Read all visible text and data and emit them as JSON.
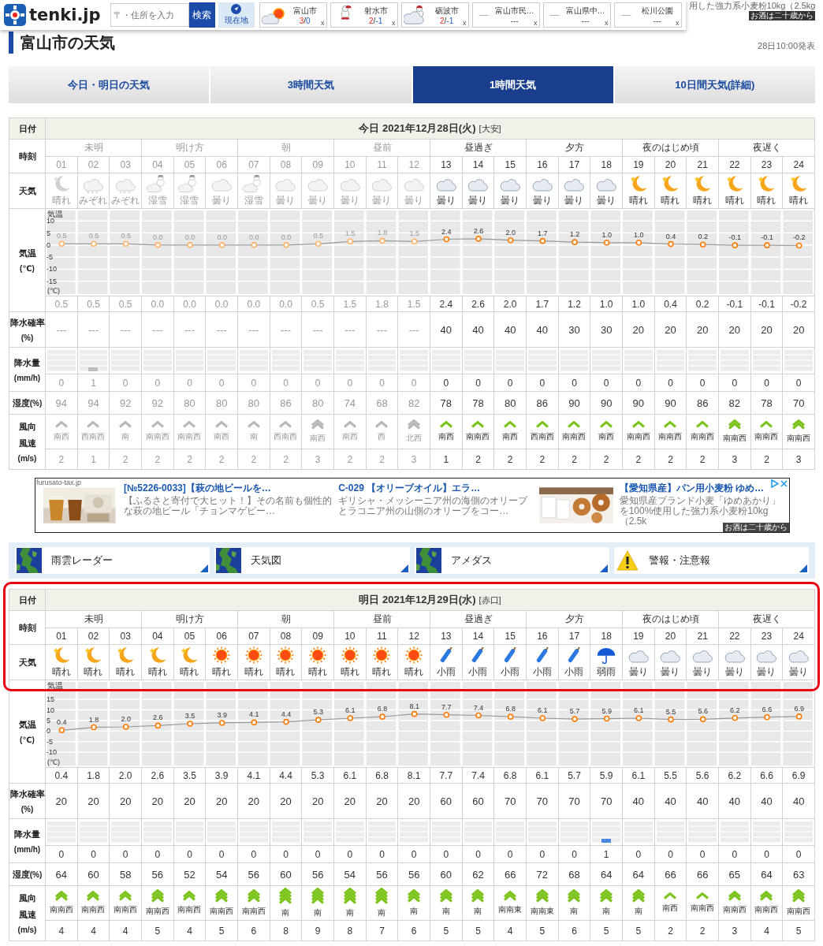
{
  "header": {
    "logo": "tenki.jp",
    "search": {
      "placeholder": "〒・住所を入力",
      "button": "検索"
    },
    "current_location": "現在地",
    "locations": [
      {
        "kind": "sun_cloud",
        "name": "富山市",
        "high": "3",
        "sep": "/",
        "low": "0",
        "close": "x"
      },
      {
        "kind": "snowman",
        "name": "射水市",
        "high": "2",
        "sep": "/",
        "low": "-1",
        "close": "x"
      },
      {
        "kind": "snow_cloud",
        "name": "砺波市",
        "high": "2",
        "sep": "/",
        "low": "-1",
        "close": "x"
      },
      {
        "kind": "empty",
        "mark": "—",
        "name": "富山市民…",
        "value": "---",
        "close": "x"
      },
      {
        "kind": "empty",
        "mark": "—",
        "name": "富山県中…",
        "value": "---",
        "close": "x"
      },
      {
        "kind": "empty",
        "mark": "—",
        "name": "松川公園",
        "value": "---",
        "close": "x"
      }
    ],
    "ad_fragment": {
      "text": "用した強力系小麦粉10kg（2.5kg",
      "badge": "お酒は二十歳から"
    }
  },
  "page": {
    "title": "富山市の天気",
    "issued": "28日10:00発表"
  },
  "tabs": [
    {
      "label": "今日・明日の天気",
      "selected": false
    },
    {
      "label": "3時間天気",
      "selected": false
    },
    {
      "label": "1時間天気",
      "selected": true
    },
    {
      "label": "10日間天気(詳細)",
      "selected": false
    }
  ],
  "tables": [
    {
      "highlighted": false,
      "date": "今日 2021年12月28日(火)",
      "rokuyo": "[大安]",
      "labels": {
        "date": "日付",
        "time": "時刻",
        "weather": "天気",
        "temp": "気温",
        "temp_unit": "(℃)",
        "pop": "降水確率",
        "pop_unit": "(%)",
        "rain": "降水量",
        "rain_unit": "(mm/h)",
        "humidity": "湿度",
        "humidity_unit": "(%)",
        "wind_dir": "風向",
        "wind_speed": "風速",
        "wind_unit": "(m/s)"
      },
      "periods": [
        {
          "label": "未明",
          "past": true
        },
        {
          "label": "明け方",
          "past": true
        },
        {
          "label": "朝",
          "past": true
        },
        {
          "label": "昼前",
          "past": true
        },
        {
          "label": "昼過ぎ",
          "past": false
        },
        {
          "label": "夕方",
          "past": false
        },
        {
          "label": "夜のはじめ頃",
          "past": false
        },
        {
          "label": "夜遅く",
          "past": false
        }
      ],
      "chart_unit": "(℃)",
      "chart_data": {
        "type": "line",
        "yticks": [
          10,
          5,
          0,
          -5,
          -10,
          -15
        ],
        "ylim": [
          -21,
          15
        ],
        "grid": true,
        "series": [
          {
            "name": "気温",
            "color": "#999999",
            "marker": true,
            "values": [
              0.5,
              0.5,
              0.5,
              0.0,
              0.0,
              0.0,
              0.0,
              0.0,
              0.5,
              1.5,
              1.8,
              1.5,
              2.4,
              2.6,
              2.0,
              1.7,
              1.2,
              1.0,
              1.0,
              0.4,
              0.2,
              -0.1,
              -0.1,
              -0.2
            ]
          }
        ],
        "value_labels": [
          "0.5",
          "0.5",
          "0.5",
          "0.0",
          "0.0",
          "0.0",
          "0.0",
          "0.0",
          "0.5",
          "1.5",
          "1.8",
          "1.5",
          "2.4",
          "2.6",
          "2.0",
          "1.7",
          "1.2",
          "1.0",
          "1.0",
          "0.4",
          "0.2",
          "-0.1",
          "-0.1",
          "-0.2"
        ]
      },
      "hours": [
        {
          "hour": "01",
          "past": true,
          "kind": "moon",
          "weather": "晴れ",
          "temp": "0.5",
          "pop": "---",
          "rain": "0",
          "humidity": "94",
          "wind_dir": "南西",
          "wind_speed": "2"
        },
        {
          "hour": "02",
          "past": true,
          "kind": "sleet",
          "weather": "みぞれ",
          "temp": "0.5",
          "pop": "---",
          "rain": "1",
          "humidity": "94",
          "wind_dir": "西南西",
          "wind_speed": "1"
        },
        {
          "hour": "03",
          "past": true,
          "kind": "sleet",
          "weather": "みぞれ",
          "temp": "0.5",
          "pop": "---",
          "rain": "0",
          "humidity": "92",
          "wind_dir": "南",
          "wind_speed": "2"
        },
        {
          "hour": "04",
          "past": true,
          "kind": "wet_snow",
          "weather": "湿雪",
          "temp": "0.0",
          "pop": "---",
          "rain": "0",
          "humidity": "92",
          "wind_dir": "南南西",
          "wind_speed": "2"
        },
        {
          "hour": "05",
          "past": true,
          "kind": "wet_snow",
          "weather": "湿雪",
          "temp": "0.0",
          "pop": "---",
          "rain": "0",
          "humidity": "80",
          "wind_dir": "南南西",
          "wind_speed": "2"
        },
        {
          "hour": "06",
          "past": true,
          "kind": "cloud",
          "weather": "曇り",
          "temp": "0.0",
          "pop": "---",
          "rain": "0",
          "humidity": "80",
          "wind_dir": "南西",
          "wind_speed": "2"
        },
        {
          "hour": "07",
          "past": true,
          "kind": "wet_snow",
          "weather": "湿雪",
          "temp": "0.0",
          "pop": "---",
          "rain": "0",
          "humidity": "80",
          "wind_dir": "南",
          "wind_speed": "2"
        },
        {
          "hour": "08",
          "past": true,
          "kind": "cloud",
          "weather": "曇り",
          "temp": "0.0",
          "pop": "---",
          "rain": "0",
          "humidity": "86",
          "wind_dir": "西南西",
          "wind_speed": "2"
        },
        {
          "hour": "09",
          "past": true,
          "kind": "cloud",
          "weather": "曇り",
          "temp": "0.5",
          "pop": "---",
          "rain": "0",
          "humidity": "80",
          "wind_dir": "南西",
          "wind_speed": "3"
        },
        {
          "hour": "10",
          "past": true,
          "kind": "cloud",
          "weather": "曇り",
          "temp": "1.5",
          "pop": "---",
          "rain": "0",
          "humidity": "74",
          "wind_dir": "南西",
          "wind_speed": "2"
        },
        {
          "hour": "11",
          "past": true,
          "kind": "cloud",
          "weather": "曇り",
          "temp": "1.8",
          "pop": "---",
          "rain": "0",
          "humidity": "68",
          "wind_dir": "西",
          "wind_speed": "2"
        },
        {
          "hour": "12",
          "past": true,
          "kind": "cloud",
          "weather": "曇り",
          "temp": "1.5",
          "pop": "---",
          "rain": "0",
          "humidity": "82",
          "wind_dir": "北西",
          "wind_speed": "3"
        },
        {
          "hour": "13",
          "past": false,
          "kind": "cloud",
          "weather": "曇り",
          "temp": "2.4",
          "pop": "40",
          "rain": "0",
          "humidity": "78",
          "wind_dir": "南西",
          "wind_speed": "1"
        },
        {
          "hour": "14",
          "past": false,
          "kind": "cloud",
          "weather": "曇り",
          "temp": "2.6",
          "pop": "40",
          "rain": "0",
          "humidity": "78",
          "wind_dir": "南南西",
          "wind_speed": "2"
        },
        {
          "hour": "15",
          "past": false,
          "kind": "cloud",
          "weather": "曇り",
          "temp": "2.0",
          "pop": "40",
          "rain": "0",
          "humidity": "80",
          "wind_dir": "南西",
          "wind_speed": "2"
        },
        {
          "hour": "16",
          "past": false,
          "kind": "cloud",
          "weather": "曇り",
          "temp": "1.7",
          "pop": "40",
          "rain": "0",
          "humidity": "86",
          "wind_dir": "西南西",
          "wind_speed": "2"
        },
        {
          "hour": "17",
          "past": false,
          "kind": "cloud",
          "weather": "曇り",
          "temp": "1.2",
          "pop": "30",
          "rain": "0",
          "humidity": "90",
          "wind_dir": "南南西",
          "wind_speed": "2"
        },
        {
          "hour": "18",
          "past": false,
          "kind": "cloud",
          "weather": "曇り",
          "temp": "1.0",
          "pop": "30",
          "rain": "0",
          "humidity": "90",
          "wind_dir": "南西",
          "wind_speed": "2"
        },
        {
          "hour": "19",
          "past": false,
          "kind": "moon",
          "weather": "晴れ",
          "temp": "1.0",
          "pop": "20",
          "rain": "0",
          "humidity": "90",
          "wind_dir": "南南西",
          "wind_speed": "2"
        },
        {
          "hour": "20",
          "past": false,
          "kind": "moon",
          "weather": "晴れ",
          "temp": "0.4",
          "pop": "20",
          "rain": "0",
          "humidity": "90",
          "wind_dir": "南南西",
          "wind_speed": "2"
        },
        {
          "hour": "21",
          "past": false,
          "kind": "moon",
          "weather": "晴れ",
          "temp": "0.2",
          "pop": "20",
          "rain": "0",
          "humidity": "86",
          "wind_dir": "南南西",
          "wind_speed": "2"
        },
        {
          "hour": "22",
          "past": false,
          "kind": "moon",
          "weather": "晴れ",
          "temp": "-0.1",
          "pop": "20",
          "rain": "0",
          "humidity": "82",
          "wind_dir": "南南西",
          "wind_speed": "3"
        },
        {
          "hour": "23",
          "past": false,
          "kind": "moon",
          "weather": "晴れ",
          "temp": "-0.1",
          "pop": "20",
          "rain": "0",
          "humidity": "78",
          "wind_dir": "南南西",
          "wind_speed": "2"
        },
        {
          "hour": "24",
          "past": false,
          "kind": "moon",
          "weather": "晴れ",
          "temp": "-0.2",
          "pop": "20",
          "rain": "0",
          "humidity": "70",
          "wind_dir": "南南西",
          "wind_speed": "3"
        }
      ]
    },
    {
      "highlighted": true,
      "date": "明日 2021年12月29日(水)",
      "rokuyo": "[赤口]",
      "labels": {
        "date": "日付",
        "time": "時刻",
        "weather": "天気",
        "temp": "気温",
        "temp_unit": "(℃)",
        "pop": "降水確率",
        "pop_unit": "(%)",
        "rain": "降水量",
        "rain_unit": "(mm/h)",
        "humidity": "湿度",
        "humidity_unit": "(%)",
        "wind_dir": "風向",
        "wind_speed": "風速",
        "wind_unit": "(m/s)"
      },
      "periods": [
        {
          "label": "未明",
          "past": false
        },
        {
          "label": "明け方",
          "past": false
        },
        {
          "label": "朝",
          "past": false
        },
        {
          "label": "昼前",
          "past": false
        },
        {
          "label": "昼過ぎ",
          "past": false
        },
        {
          "label": "夕方",
          "past": false
        },
        {
          "label": "夜のはじめ頃",
          "past": false
        },
        {
          "label": "夜遅く",
          "past": false
        }
      ],
      "chart_unit": "(℃)",
      "chart_data": {
        "type": "line",
        "yticks": [
          15,
          10,
          5,
          0,
          -5,
          -10
        ],
        "ylim": [
          -17,
          24
        ],
        "grid": true,
        "series": [
          {
            "name": "気温",
            "color": "#999999",
            "marker": true,
            "values": [
              0.4,
              1.8,
              2.0,
              2.6,
              3.5,
              3.9,
              4.1,
              4.4,
              5.3,
              6.1,
              6.8,
              8.1,
              7.7,
              7.4,
              6.8,
              6.1,
              5.7,
              5.9,
              6.1,
              5.5,
              5.6,
              6.2,
              6.6,
              6.9
            ]
          }
        ],
        "value_labels": [
          "0.4",
          "1.8",
          "2.0",
          "2.6",
          "3.5",
          "3.9",
          "4.1",
          "4.4",
          "5.3",
          "6.1",
          "6.8",
          "8.1",
          "7.7",
          "7.4",
          "6.8",
          "6.1",
          "5.7",
          "5.9",
          "6.1",
          "5.5",
          "5.6",
          "6.2",
          "6.6",
          "6.9"
        ]
      },
      "hours": [
        {
          "hour": "01",
          "past": false,
          "kind": "moon",
          "weather": "晴れ",
          "temp": "0.4",
          "pop": "20",
          "rain": "0",
          "humidity": "64",
          "wind_dir": "南南西",
          "wind_speed": "4"
        },
        {
          "hour": "02",
          "past": false,
          "kind": "moon",
          "weather": "晴れ",
          "temp": "1.8",
          "pop": "20",
          "rain": "0",
          "humidity": "60",
          "wind_dir": "南南西",
          "wind_speed": "4"
        },
        {
          "hour": "03",
          "past": false,
          "kind": "moon",
          "weather": "晴れ",
          "temp": "2.0",
          "pop": "20",
          "rain": "0",
          "humidity": "58",
          "wind_dir": "南南西",
          "wind_speed": "4"
        },
        {
          "hour": "04",
          "past": false,
          "kind": "moon",
          "weather": "晴れ",
          "temp": "2.6",
          "pop": "20",
          "rain": "0",
          "humidity": "56",
          "wind_dir": "南南西",
          "wind_speed": "5"
        },
        {
          "hour": "05",
          "past": false,
          "kind": "moon",
          "weather": "晴れ",
          "temp": "3.5",
          "pop": "20",
          "rain": "0",
          "humidity": "52",
          "wind_dir": "南南西",
          "wind_speed": "4"
        },
        {
          "hour": "06",
          "past": false,
          "kind": "sun",
          "weather": "晴れ",
          "temp": "3.9",
          "pop": "20",
          "rain": "0",
          "humidity": "54",
          "wind_dir": "南南西",
          "wind_speed": "5"
        },
        {
          "hour": "07",
          "past": false,
          "kind": "sun",
          "weather": "晴れ",
          "temp": "4.1",
          "pop": "20",
          "rain": "0",
          "humidity": "56",
          "wind_dir": "南南西",
          "wind_speed": "6"
        },
        {
          "hour": "08",
          "past": false,
          "kind": "sun",
          "weather": "晴れ",
          "temp": "4.4",
          "pop": "20",
          "rain": "0",
          "humidity": "60",
          "wind_dir": "南",
          "wind_speed": "8"
        },
        {
          "hour": "09",
          "past": false,
          "kind": "sun",
          "weather": "晴れ",
          "temp": "5.3",
          "pop": "20",
          "rain": "0",
          "humidity": "56",
          "wind_dir": "南",
          "wind_speed": "9"
        },
        {
          "hour": "10",
          "past": false,
          "kind": "sun",
          "weather": "晴れ",
          "temp": "6.1",
          "pop": "20",
          "rain": "0",
          "humidity": "54",
          "wind_dir": "南",
          "wind_speed": "8"
        },
        {
          "hour": "11",
          "past": false,
          "kind": "sun",
          "weather": "晴れ",
          "temp": "6.8",
          "pop": "20",
          "rain": "0",
          "humidity": "56",
          "wind_dir": "南",
          "wind_speed": "7"
        },
        {
          "hour": "12",
          "past": false,
          "kind": "sun",
          "weather": "晴れ",
          "temp": "8.1",
          "pop": "20",
          "rain": "0",
          "humidity": "56",
          "wind_dir": "南",
          "wind_speed": "6"
        },
        {
          "hour": "13",
          "past": false,
          "kind": "light_rain",
          "weather": "小雨",
          "temp": "7.7",
          "pop": "60",
          "rain": "0",
          "humidity": "60",
          "wind_dir": "南",
          "wind_speed": "5"
        },
        {
          "hour": "14",
          "past": false,
          "kind": "light_rain",
          "weather": "小雨",
          "temp": "7.4",
          "pop": "60",
          "rain": "0",
          "humidity": "62",
          "wind_dir": "南",
          "wind_speed": "5"
        },
        {
          "hour": "15",
          "past": false,
          "kind": "light_rain",
          "weather": "小雨",
          "temp": "6.8",
          "pop": "70",
          "rain": "0",
          "humidity": "66",
          "wind_dir": "南南東",
          "wind_speed": "4"
        },
        {
          "hour": "16",
          "past": false,
          "kind": "light_rain",
          "weather": "小雨",
          "temp": "6.1",
          "pop": "70",
          "rain": "0",
          "humidity": "72",
          "wind_dir": "南南東",
          "wind_speed": "5"
        },
        {
          "hour": "17",
          "past": false,
          "kind": "light_rain",
          "weather": "小雨",
          "temp": "5.7",
          "pop": "70",
          "rain": "0",
          "humidity": "68",
          "wind_dir": "南",
          "wind_speed": "6"
        },
        {
          "hour": "18",
          "past": false,
          "kind": "rain",
          "weather": "弱雨",
          "temp": "5.9",
          "pop": "70",
          "rain": "1",
          "humidity": "64",
          "wind_dir": "南",
          "wind_speed": "5"
        },
        {
          "hour": "19",
          "past": false,
          "kind": "cloud",
          "weather": "曇り",
          "temp": "6.1",
          "pop": "40",
          "rain": "0",
          "humidity": "64",
          "wind_dir": "南",
          "wind_speed": "5"
        },
        {
          "hour": "20",
          "past": false,
          "kind": "cloud",
          "weather": "曇り",
          "temp": "5.5",
          "pop": "40",
          "rain": "0",
          "humidity": "66",
          "wind_dir": "南西",
          "wind_speed": "2"
        },
        {
          "hour": "21",
          "past": false,
          "kind": "cloud",
          "weather": "曇り",
          "temp": "5.6",
          "pop": "40",
          "rain": "0",
          "humidity": "66",
          "wind_dir": "南南西",
          "wind_speed": "2"
        },
        {
          "hour": "22",
          "past": false,
          "kind": "cloud",
          "weather": "曇り",
          "temp": "6.2",
          "pop": "40",
          "rain": "0",
          "humidity": "65",
          "wind_dir": "南南西",
          "wind_speed": "3"
        },
        {
          "hour": "23",
          "past": false,
          "kind": "cloud",
          "weather": "曇り",
          "temp": "6.6",
          "pop": "40",
          "rain": "0",
          "humidity": "64",
          "wind_dir": "南南西",
          "wind_speed": "4"
        },
        {
          "hour": "24",
          "past": false,
          "kind": "cloud",
          "weather": "曇り",
          "temp": "6.9",
          "pop": "40",
          "rain": "0",
          "humidity": "63",
          "wind_dir": "南南西",
          "wind_speed": "5"
        }
      ]
    }
  ],
  "ad": {
    "source": "furusato-tax.jp",
    "badge": "お酒は二十歳から",
    "items": [
      {
        "kind": "picture",
        "title": "[№5226-0033]【萩の地ビールを…",
        "description": "【ふるさと寄付で大ヒット！】その名前も個性的な萩の地ビール「チョンマゲビー…"
      },
      {
        "kind": "text",
        "title": "C-029 【オリーブオイル】エラ…",
        "description": "ギリシャ・メッシーニア州の海側のオリーブとラコニア州の山側のオリーブをコー…"
      },
      {
        "kind": "picture",
        "title": "【愛知県産】パン用小麦粉 ゆめ…",
        "description": "愛知県産ブランド小麦「ゆめあかり」を100%使用した強力系小麦粉10kg（2.5k"
      }
    ]
  },
  "links": [
    {
      "kind": "map",
      "label": "雨雲レーダー"
    },
    {
      "kind": "map",
      "label": "天気図"
    },
    {
      "kind": "map",
      "label": "アメダス"
    },
    {
      "kind": "warning",
      "label": "警報・注意報"
    }
  ]
}
